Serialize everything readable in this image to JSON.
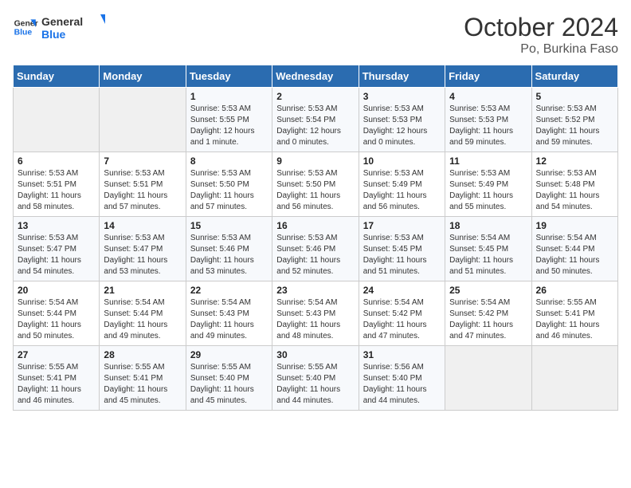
{
  "header": {
    "logo_text_general": "General",
    "logo_text_blue": "Blue",
    "month_title": "October 2024",
    "subtitle": "Po, Burkina Faso"
  },
  "weekdays": [
    "Sunday",
    "Monday",
    "Tuesday",
    "Wednesday",
    "Thursday",
    "Friday",
    "Saturday"
  ],
  "weeks": [
    [
      {
        "day": "",
        "sunrise": "",
        "sunset": "",
        "daylight": ""
      },
      {
        "day": "",
        "sunrise": "",
        "sunset": "",
        "daylight": ""
      },
      {
        "day": "1",
        "sunrise": "Sunrise: 5:53 AM",
        "sunset": "Sunset: 5:55 PM",
        "daylight": "Daylight: 12 hours and 1 minute."
      },
      {
        "day": "2",
        "sunrise": "Sunrise: 5:53 AM",
        "sunset": "Sunset: 5:54 PM",
        "daylight": "Daylight: 12 hours and 0 minutes."
      },
      {
        "day": "3",
        "sunrise": "Sunrise: 5:53 AM",
        "sunset": "Sunset: 5:53 PM",
        "daylight": "Daylight: 12 hours and 0 minutes."
      },
      {
        "day": "4",
        "sunrise": "Sunrise: 5:53 AM",
        "sunset": "Sunset: 5:53 PM",
        "daylight": "Daylight: 11 hours and 59 minutes."
      },
      {
        "day": "5",
        "sunrise": "Sunrise: 5:53 AM",
        "sunset": "Sunset: 5:52 PM",
        "daylight": "Daylight: 11 hours and 59 minutes."
      }
    ],
    [
      {
        "day": "6",
        "sunrise": "Sunrise: 5:53 AM",
        "sunset": "Sunset: 5:51 PM",
        "daylight": "Daylight: 11 hours and 58 minutes."
      },
      {
        "day": "7",
        "sunrise": "Sunrise: 5:53 AM",
        "sunset": "Sunset: 5:51 PM",
        "daylight": "Daylight: 11 hours and 57 minutes."
      },
      {
        "day": "8",
        "sunrise": "Sunrise: 5:53 AM",
        "sunset": "Sunset: 5:50 PM",
        "daylight": "Daylight: 11 hours and 57 minutes."
      },
      {
        "day": "9",
        "sunrise": "Sunrise: 5:53 AM",
        "sunset": "Sunset: 5:50 PM",
        "daylight": "Daylight: 11 hours and 56 minutes."
      },
      {
        "day": "10",
        "sunrise": "Sunrise: 5:53 AM",
        "sunset": "Sunset: 5:49 PM",
        "daylight": "Daylight: 11 hours and 56 minutes."
      },
      {
        "day": "11",
        "sunrise": "Sunrise: 5:53 AM",
        "sunset": "Sunset: 5:49 PM",
        "daylight": "Daylight: 11 hours and 55 minutes."
      },
      {
        "day": "12",
        "sunrise": "Sunrise: 5:53 AM",
        "sunset": "Sunset: 5:48 PM",
        "daylight": "Daylight: 11 hours and 54 minutes."
      }
    ],
    [
      {
        "day": "13",
        "sunrise": "Sunrise: 5:53 AM",
        "sunset": "Sunset: 5:47 PM",
        "daylight": "Daylight: 11 hours and 54 minutes."
      },
      {
        "day": "14",
        "sunrise": "Sunrise: 5:53 AM",
        "sunset": "Sunset: 5:47 PM",
        "daylight": "Daylight: 11 hours and 53 minutes."
      },
      {
        "day": "15",
        "sunrise": "Sunrise: 5:53 AM",
        "sunset": "Sunset: 5:46 PM",
        "daylight": "Daylight: 11 hours and 53 minutes."
      },
      {
        "day": "16",
        "sunrise": "Sunrise: 5:53 AM",
        "sunset": "Sunset: 5:46 PM",
        "daylight": "Daylight: 11 hours and 52 minutes."
      },
      {
        "day": "17",
        "sunrise": "Sunrise: 5:53 AM",
        "sunset": "Sunset: 5:45 PM",
        "daylight": "Daylight: 11 hours and 51 minutes."
      },
      {
        "day": "18",
        "sunrise": "Sunrise: 5:54 AM",
        "sunset": "Sunset: 5:45 PM",
        "daylight": "Daylight: 11 hours and 51 minutes."
      },
      {
        "day": "19",
        "sunrise": "Sunrise: 5:54 AM",
        "sunset": "Sunset: 5:44 PM",
        "daylight": "Daylight: 11 hours and 50 minutes."
      }
    ],
    [
      {
        "day": "20",
        "sunrise": "Sunrise: 5:54 AM",
        "sunset": "Sunset: 5:44 PM",
        "daylight": "Daylight: 11 hours and 50 minutes."
      },
      {
        "day": "21",
        "sunrise": "Sunrise: 5:54 AM",
        "sunset": "Sunset: 5:44 PM",
        "daylight": "Daylight: 11 hours and 49 minutes."
      },
      {
        "day": "22",
        "sunrise": "Sunrise: 5:54 AM",
        "sunset": "Sunset: 5:43 PM",
        "daylight": "Daylight: 11 hours and 49 minutes."
      },
      {
        "day": "23",
        "sunrise": "Sunrise: 5:54 AM",
        "sunset": "Sunset: 5:43 PM",
        "daylight": "Daylight: 11 hours and 48 minutes."
      },
      {
        "day": "24",
        "sunrise": "Sunrise: 5:54 AM",
        "sunset": "Sunset: 5:42 PM",
        "daylight": "Daylight: 11 hours and 47 minutes."
      },
      {
        "day": "25",
        "sunrise": "Sunrise: 5:54 AM",
        "sunset": "Sunset: 5:42 PM",
        "daylight": "Daylight: 11 hours and 47 minutes."
      },
      {
        "day": "26",
        "sunrise": "Sunrise: 5:55 AM",
        "sunset": "Sunset: 5:41 PM",
        "daylight": "Daylight: 11 hours and 46 minutes."
      }
    ],
    [
      {
        "day": "27",
        "sunrise": "Sunrise: 5:55 AM",
        "sunset": "Sunset: 5:41 PM",
        "daylight": "Daylight: 11 hours and 46 minutes."
      },
      {
        "day": "28",
        "sunrise": "Sunrise: 5:55 AM",
        "sunset": "Sunset: 5:41 PM",
        "daylight": "Daylight: 11 hours and 45 minutes."
      },
      {
        "day": "29",
        "sunrise": "Sunrise: 5:55 AM",
        "sunset": "Sunset: 5:40 PM",
        "daylight": "Daylight: 11 hours and 45 minutes."
      },
      {
        "day": "30",
        "sunrise": "Sunrise: 5:55 AM",
        "sunset": "Sunset: 5:40 PM",
        "daylight": "Daylight: 11 hours and 44 minutes."
      },
      {
        "day": "31",
        "sunrise": "Sunrise: 5:56 AM",
        "sunset": "Sunset: 5:40 PM",
        "daylight": "Daylight: 11 hours and 44 minutes."
      },
      {
        "day": "",
        "sunrise": "",
        "sunset": "",
        "daylight": ""
      },
      {
        "day": "",
        "sunrise": "",
        "sunset": "",
        "daylight": ""
      }
    ]
  ]
}
